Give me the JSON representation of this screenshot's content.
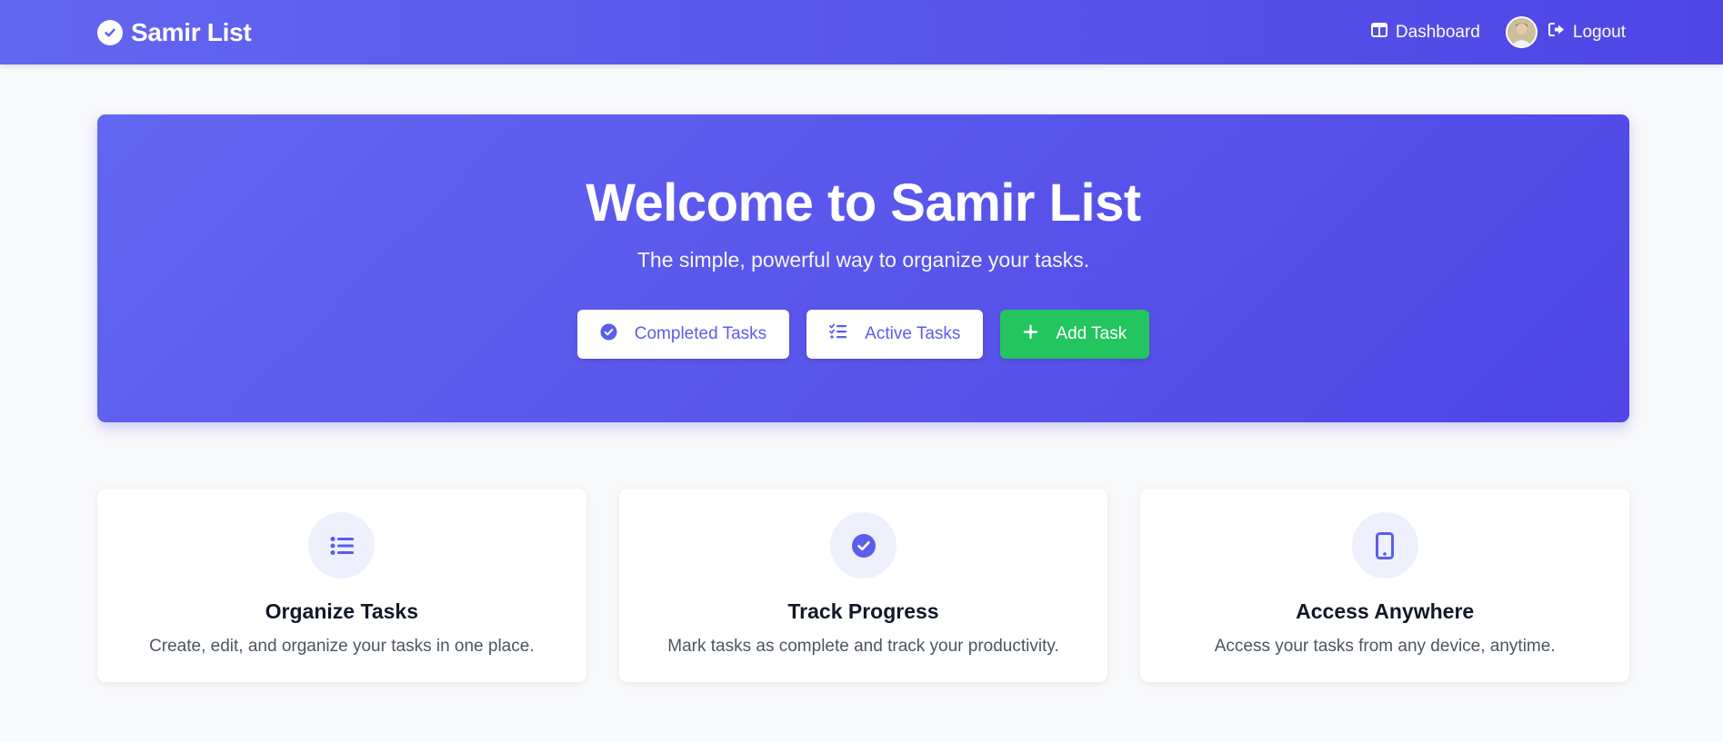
{
  "navbar": {
    "brand": "Samir List",
    "dashboard_label": "Dashboard",
    "logout_label": "Logout"
  },
  "hero": {
    "title": "Welcome to Samir List",
    "subtitle": "The simple, powerful way to organize your tasks.",
    "buttons": [
      {
        "label": "Completed Tasks",
        "icon": "check-circle-icon"
      },
      {
        "label": "Active Tasks",
        "icon": "list-check-icon"
      },
      {
        "label": "Add Task",
        "icon": "plus-icon"
      }
    ]
  },
  "features": [
    {
      "icon": "list-icon",
      "title": "Organize Tasks",
      "description": "Create, edit, and organize your tasks in one place."
    },
    {
      "icon": "check-circle-icon",
      "title": "Track Progress",
      "description": "Mark tasks as complete and track your productivity."
    },
    {
      "icon": "mobile-icon",
      "title": "Access Anywhere",
      "description": "Access your tasks from any device, anytime."
    }
  ],
  "colors": {
    "primary": "#6366f1",
    "primary_dark": "#4f46e5",
    "success": "#22c55e",
    "background": "#f8f9fb"
  }
}
